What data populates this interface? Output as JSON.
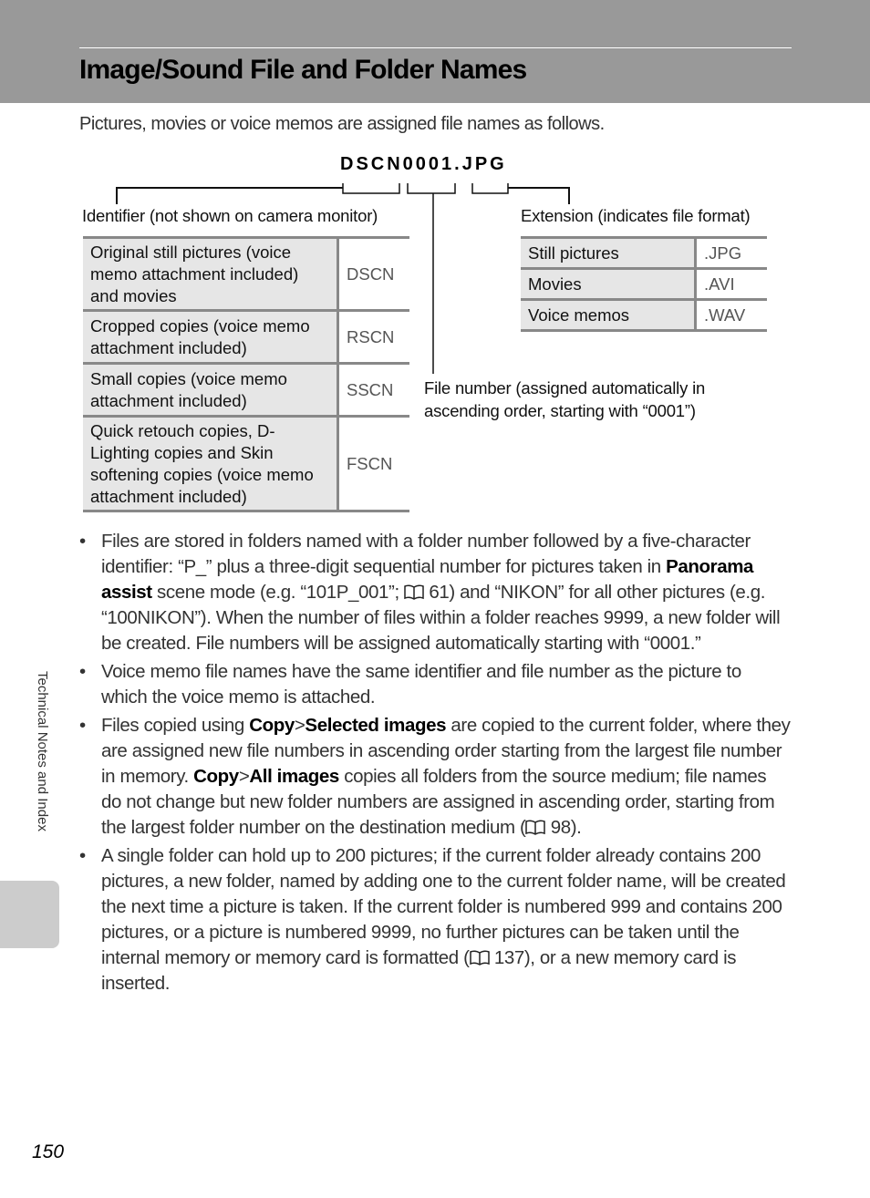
{
  "header": {
    "title": "Image/Sound File and Folder Names"
  },
  "intro": "Pictures, movies or voice memos are assigned file names as follows.",
  "diagram": {
    "filename": "DSCN0001.JPG",
    "identifier_label": "Identifier (not shown on camera monitor)",
    "extension_label": "Extension (indicates file format)",
    "file_number_label_line1": "File number (assigned automatically in",
    "file_number_label_line2": "ascending order, starting with “0001”)"
  },
  "identifier_table": {
    "rows": [
      {
        "description": "Original still pictures (voice memo attachment included) and movies",
        "code": "DSCN"
      },
      {
        "description": "Cropped copies (voice memo attachment included)",
        "code": "RSCN"
      },
      {
        "description": "Small copies (voice memo attachment included)",
        "code": "SSCN"
      },
      {
        "description": "Quick retouch copies, D-Lighting copies and Skin softening copies (voice memo attachment included)",
        "code": "FSCN"
      }
    ]
  },
  "extension_table": {
    "rows": [
      {
        "type": "Still pictures",
        "ext": ".JPG"
      },
      {
        "type": "Movies",
        "ext": ".AVI"
      },
      {
        "type": "Voice memos",
        "ext": ".WAV"
      }
    ]
  },
  "bullets": [
    {
      "p1": "Files are stored in folders named with a folder number followed by a five-character identifier: “P_” plus a three-digit sequential number for pictures taken in ",
      "b1": "Panorama assist",
      "p2": " scene mode (e.g. “101P_001”; ",
      "ref": "61",
      "p3": ") and “NIKON” for all other pictures (e.g. “100NIKON”). When the number of files within a folder reaches 9999, a new folder will be created. File numbers will be assigned automatically starting with “0001.”"
    },
    {
      "p1": "Voice memo file names have the same identifier and file number as the picture to which the voice memo is attached."
    },
    {
      "p1": "Files copied using ",
      "b1": "Copy",
      "sep1": ">",
      "b2": "Selected images",
      "p2": " are copied to the current folder, where they are assigned new file numbers in ascending order starting from the largest file number in memory. ",
      "b3": "Copy",
      "sep2": ">",
      "b4": "All images",
      "p3": " copies all folders from the source medium; file names do not change but new folder numbers are assigned in ascending order, starting from the largest folder number on the destination medium (",
      "ref": "98",
      "p4": ")."
    },
    {
      "p1": "A single folder can hold up to 200 pictures; if the current folder already contains 200 pictures, a new folder, named by adding one to the current folder name, will be created the next time a picture is taken. If the current folder is numbered 999 and contains 200 pictures, or a picture is numbered 9999, no further pictures can be taken until the internal memory or memory card is formatted (",
      "ref": "137",
      "p2": "), or a new memory card is inserted."
    }
  ],
  "bullet_char": "•",
  "side_tab_label": "Technical Notes and Index",
  "page_number": "150"
}
